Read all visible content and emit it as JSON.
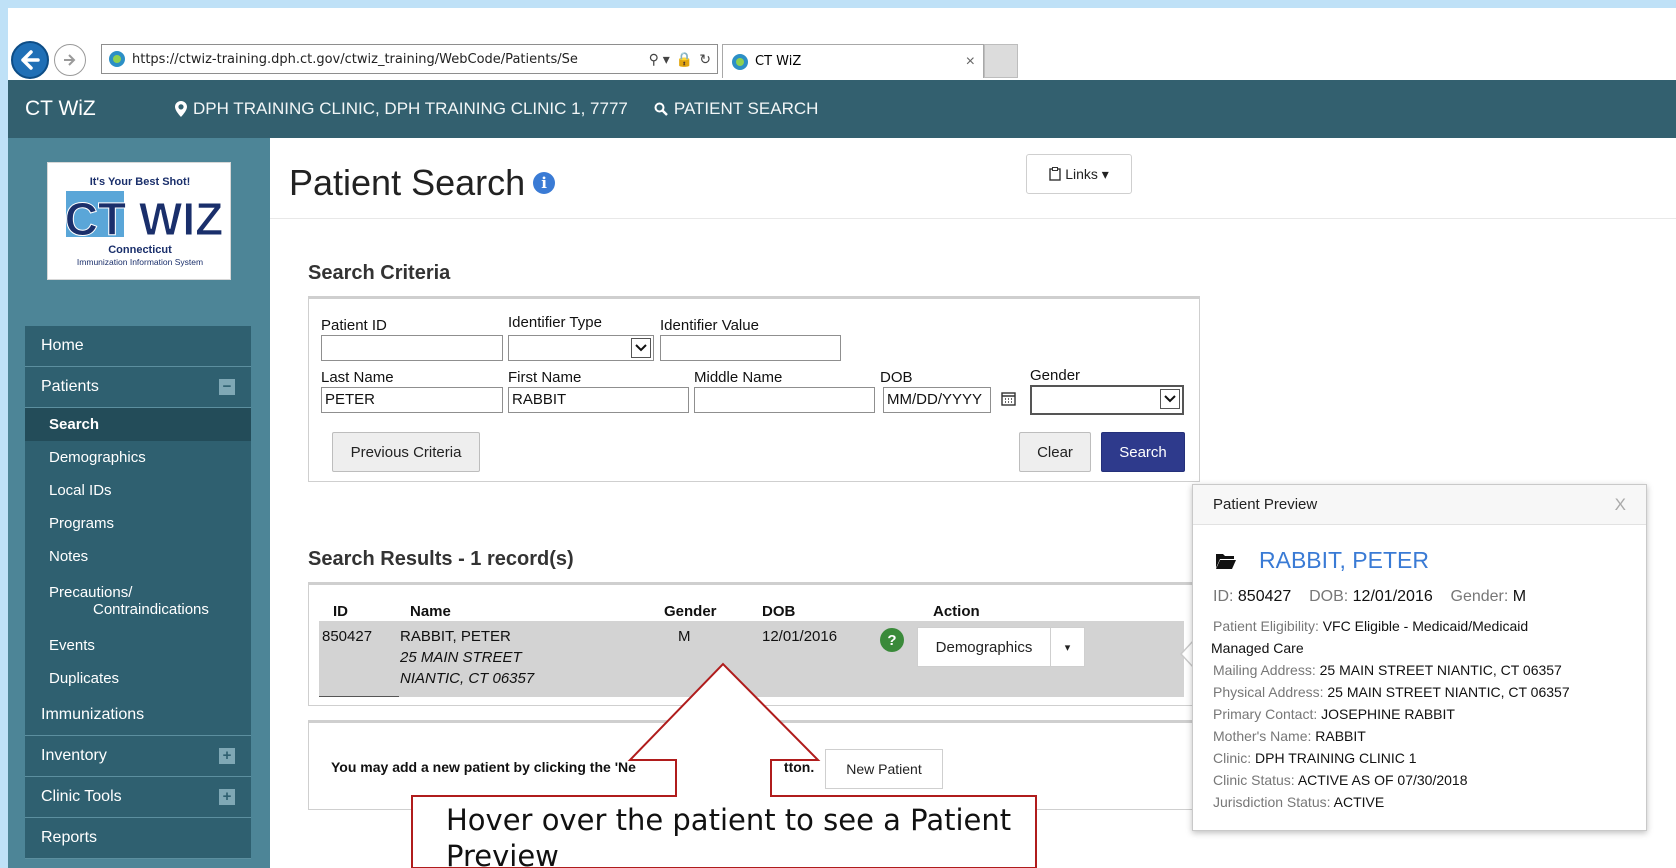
{
  "browser": {
    "url": "https://ctwiz-training.dph.ct.gov/ctwiz_training/WebCode/Patients/Se",
    "tab_title": "CT WiZ",
    "tab_close": "×",
    "search_tool": "⚲ ▾",
    "lock_tool": "🔒",
    "refresh_tool": "↻"
  },
  "header": {
    "app_name": "CT WiZ",
    "clinic": "DPH TRAINING CLINIC, DPH TRAINING CLINIC 1, 7777",
    "page": "PATIENT SEARCH"
  },
  "logo": {
    "tagline": "It's Your Best Shot!",
    "brand": "CT WIZ",
    "state": "Connecticut",
    "subtitle": "Immunization Information System"
  },
  "sidebar": {
    "home": "Home",
    "patients": "Patients",
    "patients_toggle": "−",
    "patients_sub": {
      "search": "Search",
      "demographics": "Demographics",
      "local_ids": "Local IDs",
      "programs": "Programs",
      "notes": "Notes",
      "precautions_1": "Precautions/",
      "precautions_2": "Contraindications",
      "events": "Events",
      "duplicates": "Duplicates"
    },
    "immunizations": "Immunizations",
    "inventory": "Inventory",
    "inventory_toggle": "+",
    "clinic_tools": "Clinic Tools",
    "clinic_tools_toggle": "+",
    "reports": "Reports"
  },
  "main": {
    "title": "Patient Search",
    "info_icon": "i",
    "links_label": "Links ▾",
    "criteria_title": "Search Criteria",
    "labels": {
      "patient_id": "Patient ID",
      "identifier_type": "Identifier Type",
      "identifier_value": "Identifier Value",
      "last_name": "Last Name",
      "first_name": "First Name",
      "middle_name": "Middle Name",
      "dob": "DOB",
      "gender": "Gender"
    },
    "values": {
      "patient_id": "",
      "identifier_value": "",
      "last_name": "PETER",
      "first_name": "RABBIT",
      "middle_name": "",
      "dob": "MM/DD/YYYY"
    },
    "buttons": {
      "previous_criteria": "Previous Criteria",
      "clear": "Clear",
      "search": "Search"
    },
    "results_title": "Search Results - 1 record(s)",
    "columns": [
      "ID",
      "Name",
      "Gender",
      "DOB",
      "Action"
    ],
    "row": {
      "id": "850427",
      "name": "RABBIT, PETER",
      "addr1": "25 MAIN STREET",
      "addr2": "NIANTIC, CT 06357",
      "gender": "M",
      "dob": "12/01/2016",
      "help": "?",
      "action": "Demographics",
      "caret": "▾"
    },
    "new_patient_text": "You may add a new patient by clicking the 'Ne",
    "new_patient_text_tail": "tton.",
    "new_patient_button": "New Patient"
  },
  "preview": {
    "header": "Patient Preview",
    "close": "X",
    "name": "RABBIT, PETER",
    "id_label": "ID:",
    "id": "850427",
    "dob_label": "DOB:",
    "dob": "12/01/2016",
    "gender_label": "Gender:",
    "gender": "M",
    "eligibility_label": "Patient Eligibility:",
    "eligibility": "VFC Eligible - Medicaid/Medicaid",
    "eligibility_2": "Managed Care",
    "mailing_label": "Mailing Address:",
    "mailing": "25 MAIN STREET NIANTIC, CT 06357",
    "physical_label": "Physical Address:",
    "physical": "25 MAIN STREET NIANTIC, CT 06357",
    "contact_label": "Primary Contact:",
    "contact": "JOSEPHINE RABBIT",
    "mother_label": "Mother's Name:",
    "mother": "RABBIT",
    "clinic_label": "Clinic:",
    "clinic": "DPH TRAINING CLINIC 1",
    "clinic_status_label": "Clinic Status:",
    "clinic_status": "ACTIVE AS OF 07/30/2018",
    "jurisdiction_label": "Jurisdiction Status:",
    "jurisdiction": "ACTIVE"
  },
  "callout": {
    "text": "Hover over the patient to see a Patient Preview"
  },
  "colors": {
    "header_bg": "#33606f",
    "sidebar_bg": "#4d8597",
    "menu_bg": "#2f6070",
    "primary_button": "#2e3a8c",
    "link_blue": "#3a7bd5",
    "callout_red": "#b01c1c"
  }
}
